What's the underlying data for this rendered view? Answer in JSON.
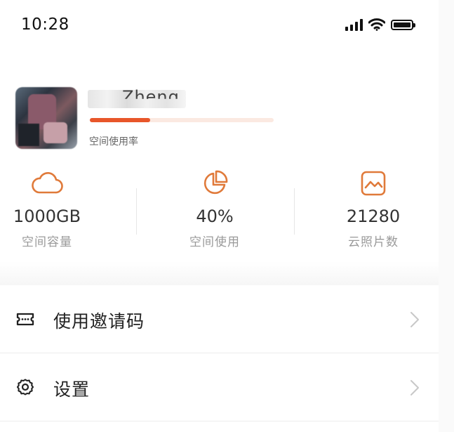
{
  "status_bar": {
    "time": "10:28",
    "icons": [
      "signal-icon",
      "wifi-icon",
      "battery-icon"
    ]
  },
  "profile": {
    "username": "Zheng",
    "usage_label": "空间使用率",
    "usage_fraction": 0.33,
    "accent_color": "#e8562a"
  },
  "stats": [
    {
      "icon": "cloud-icon",
      "value": "1000GB",
      "label": "空间容量"
    },
    {
      "icon": "pie-chart-icon",
      "value": "40%",
      "label": "空间使用"
    },
    {
      "icon": "image-icon",
      "value": "21280",
      "label": "云照片数"
    }
  ],
  "menu": [
    {
      "icon": "ticket-icon",
      "label": "使用邀请码"
    },
    {
      "icon": "gear-icon",
      "label": "设置"
    }
  ]
}
